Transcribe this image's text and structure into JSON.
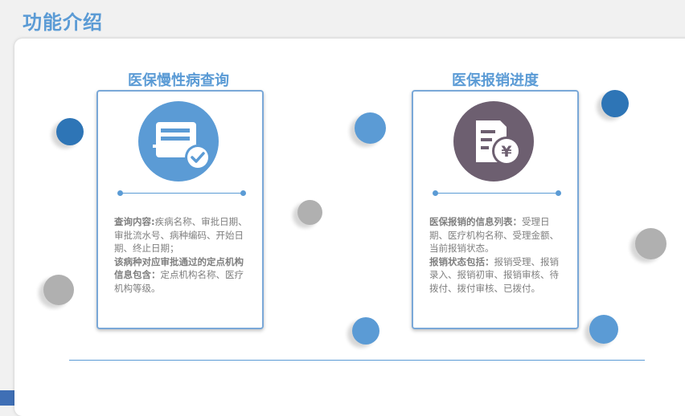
{
  "page": {
    "title": "功能介绍"
  },
  "cards": [
    {
      "title": "医保慢性病查询",
      "icon": "document-check-icon",
      "icon_color": "#5b9bd5",
      "line1_bold": "查询内容:",
      "line1_text": "疾病名称、审批日期、审批流水号、病种编码、开始日期、终止日期；",
      "line2_bold": "该病种对应审批通过的定点机构信息包含：",
      "line2_text": "定点机构名称、医疗机构等级。"
    },
    {
      "title": "医保报销进度",
      "icon": "yen-receipt-icon",
      "icon_color": "#6d5f70",
      "line1_bold": "医保报销的信息列表：",
      "line1_text": "受理日期、医疗机构名称、受理金额、当前报销状态。",
      "line2_bold": "报销状态包括：",
      "line2_text": "报销受理、报销录入、报销初审、报销审核、待拨付、拨付审核、已拨付。"
    }
  ],
  "colors": {
    "accent": "#5b9bd5",
    "dark_blue": "#2e75b6",
    "grey": "#b0b0b0",
    "text": "#7f7f7f"
  }
}
